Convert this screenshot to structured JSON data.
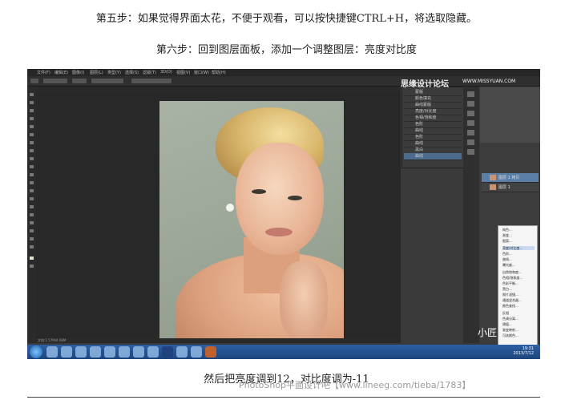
{
  "steps": {
    "step5": "第五步：如果觉得界面太花，不便于观看，可以按快捷键CTRL+H，将选取隐藏。",
    "step6": "第六步：回到图层面板，添加一个调整图层：亮度对比度"
  },
  "watermarks": {
    "top_right": "思缘设计论坛",
    "top_right_url": "WWW.MISSYUAN.COM",
    "bottom_right": "小匠",
    "bottom_text": "PhotoShop平面设计吧【www.lineeg.com/tieba/1783】"
  },
  "caption": "然后把亮度调到12，对比度调为-11",
  "screenshot": {
    "menu": [
      "文件(F)",
      "编辑(E)",
      "图像(I)",
      "图层(L)",
      "类型(Y)",
      "选择(S)",
      "滤镜(T)",
      "3D(D)",
      "视图(V)",
      "窗口(W)",
      "帮助(H)"
    ],
    "layers_popup": [
      "蒙版",
      "颜色填充",
      "曲线蒙版",
      "亮度/对比度",
      "色相/饱和度",
      "色阶",
      "曲线",
      "色阶",
      "曲线",
      "黑白",
      "曲线",
      "曲线"
    ],
    "layers_main": [
      "图层 1 拷贝",
      "图层 1"
    ],
    "context_menu": [
      "纯色...",
      "渐变...",
      "图案...",
      "亮度/对比度...",
      "色阶...",
      "曲线...",
      "曝光度...",
      "自然饱和度...",
      "色相/饱和度...",
      "色彩平衡...",
      "黑白...",
      "照片滤镜...",
      "通道混合器...",
      "颜色查找...",
      "反相",
      "色调分离...",
      "阈值...",
      "渐变映射...",
      "可选颜色..."
    ],
    "status": "文档:1.57M/4.68M",
    "clock_time": "19:31",
    "clock_date": "2013/7/12"
  }
}
